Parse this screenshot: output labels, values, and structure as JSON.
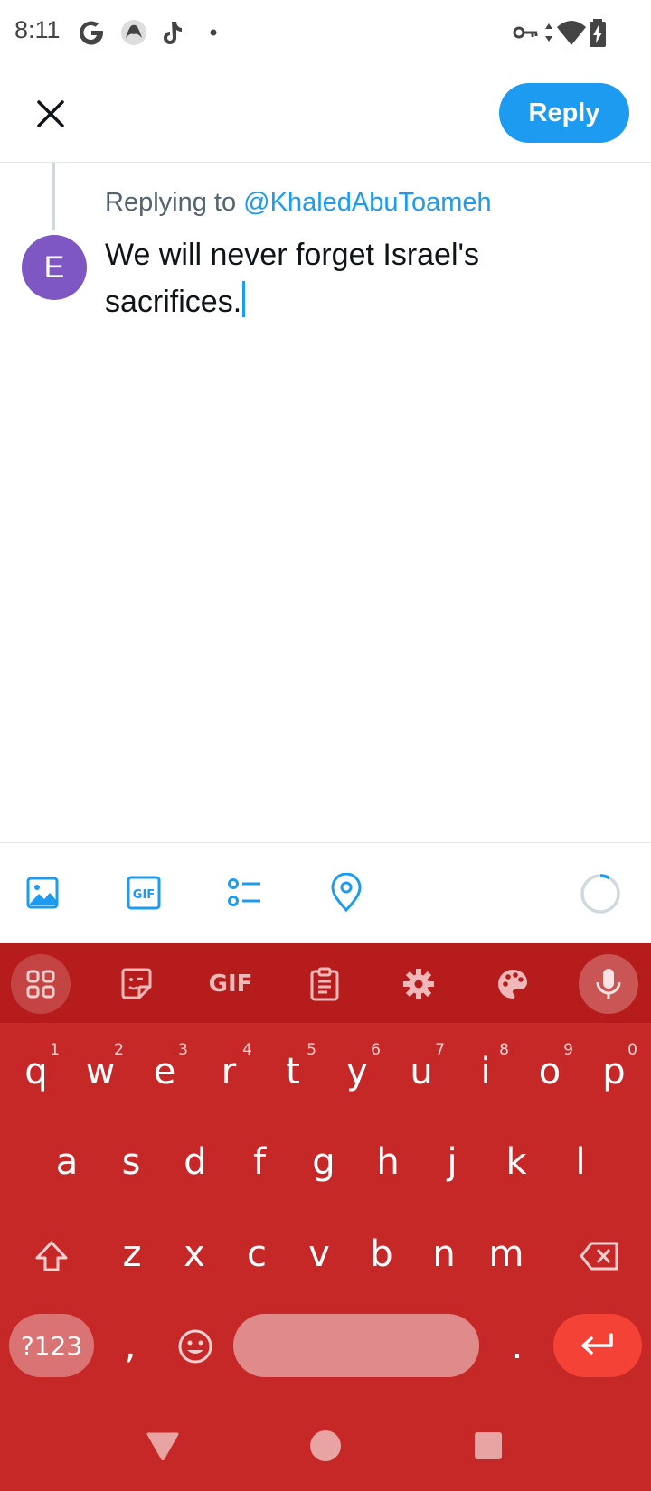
{
  "status_bar": {
    "time": "8:11",
    "icons": [
      "google-g-icon",
      "app-circle-icon",
      "tiktok-icon",
      "notification-dot-icon",
      "vpn-key-icon",
      "data-arrows-icon",
      "wifi-icon",
      "battery-charging-icon"
    ]
  },
  "header": {
    "close_icon": "close-icon",
    "reply_label": "Reply"
  },
  "compose": {
    "avatar_letter": "E",
    "replying_prefix": "Replying to ",
    "replying_handle": "@KhaledAbuToameh",
    "text": "We will never forget Israel's sacrifices."
  },
  "toolbar": {
    "icons": [
      "image-icon",
      "gif-icon",
      "poll-icon",
      "location-icon",
      "character-count-ring"
    ],
    "gif_label": "GIF"
  },
  "keyboard": {
    "top_bar": [
      "apps-grid-icon",
      "sticker-icon",
      "GIF",
      "clipboard-icon",
      "settings-gear-icon",
      "palette-icon",
      "microphone-icon"
    ],
    "row1": [
      {
        "k": "q",
        "h": "1"
      },
      {
        "k": "w",
        "h": "2"
      },
      {
        "k": "e",
        "h": "3"
      },
      {
        "k": "r",
        "h": "4"
      },
      {
        "k": "t",
        "h": "5"
      },
      {
        "k": "y",
        "h": "6"
      },
      {
        "k": "u",
        "h": "7"
      },
      {
        "k": "i",
        "h": "8"
      },
      {
        "k": "o",
        "h": "9"
      },
      {
        "k": "p",
        "h": "0"
      }
    ],
    "row2": [
      "a",
      "s",
      "d",
      "f",
      "g",
      "h",
      "j",
      "k",
      "l"
    ],
    "row3": [
      "z",
      "x",
      "c",
      "v",
      "b",
      "n",
      "m"
    ],
    "symbols_label": "?123",
    "comma": ",",
    "period": ".",
    "shift_icon": "shift-icon",
    "backspace_icon": "backspace-icon",
    "emoji_icon": "emoji-icon",
    "enter_icon": "enter-icon"
  },
  "nav_bar": [
    "back-triangle-icon",
    "home-circle-icon",
    "recents-square-icon"
  ],
  "colors": {
    "brand": "#1d9bf0",
    "keyboard_bg": "#c62828",
    "keyboard_top": "#b71c1c",
    "avatar": "#7e57c2",
    "enter_key": "#f44336"
  }
}
